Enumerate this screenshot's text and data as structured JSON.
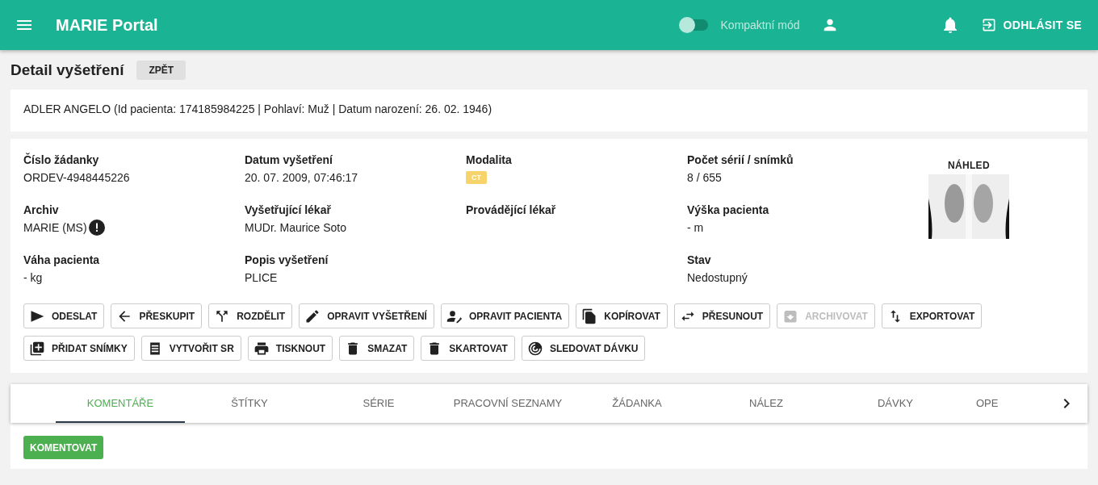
{
  "header": {
    "title": "MARIE Portal",
    "compact_mode": {
      "label": "Kompaktní mód",
      "on": false
    },
    "logout": "ODHLÁSIT SE"
  },
  "page": {
    "title": "Detail vyšetření",
    "back": "ZPĚT"
  },
  "patient": "ADLER ANGELO (Id pacienta: 174185984225 | Pohlaví: Muž | Datum narození: 26. 02. 1946)",
  "columns": [
    [
      {
        "label": "Číslo žádanky",
        "value": "ORDEV-4948445226"
      },
      {
        "label": "Archiv",
        "value": "MARIE (MS)",
        "warning": true
      },
      {
        "label": "Váha pacienta",
        "value": "- kg"
      }
    ],
    [
      {
        "label": "Datum vyšetření",
        "value": "20. 07. 2009, 07:46:17"
      },
      {
        "label": "Vyšetřující lékař",
        "value": "MUDr. Maurice Soto"
      },
      {
        "label": "Popis vyšetření",
        "value": "PLICE"
      }
    ],
    [
      {
        "label": "Modalita",
        "badge": "CT"
      },
      {
        "label": "Provádějící lékař"
      }
    ],
    [
      {
        "label": "Počet sérií / snímků",
        "value": "8 / 655"
      },
      {
        "label": "Výška pacienta",
        "value": "- m"
      },
      {
        "label": "Stav",
        "value": "Nedostupný"
      }
    ]
  ],
  "preview": {
    "label": "NÁHLED"
  },
  "actions": [
    [
      {
        "label": "ODESLAT",
        "disabled": false
      },
      {
        "label": "PŘESKUPIT",
        "disabled": false
      },
      {
        "label": "ROZDĚLIT",
        "disabled": false
      },
      {
        "label": "OPRAVIT VYŠETŘENÍ",
        "disabled": false
      },
      {
        "label": "OPRAVIT PACIENTA",
        "disabled": false
      },
      {
        "label": "KOPÍROVAT",
        "disabled": false
      },
      {
        "label": "PŘESUNOUT",
        "disabled": false
      },
      {
        "label": "ARCHIVOVAT",
        "disabled": true
      },
      {
        "label": "EXPORTOVAT",
        "disabled": false
      }
    ],
    [
      {
        "label": "PŘIDAT SNÍMKY",
        "disabled": false
      },
      {
        "label": "VYTVOŘIT SR",
        "disabled": false
      },
      {
        "label": "TISKNOUT",
        "disabled": false
      },
      {
        "label": "SMAZAT",
        "disabled": false
      },
      {
        "label": "SKARTOVAT",
        "disabled": false
      },
      {
        "label": "SLEDOVAT DÁVKU",
        "disabled": false
      }
    ]
  ],
  "tabs": [
    {
      "label": "KOMENTÁŘE",
      "selected": true
    },
    {
      "label": "ŠTÍTKY",
      "selected": false
    },
    {
      "label": "SÉRIE",
      "selected": false
    },
    {
      "label": "PRACOVNÍ SEZNAMY",
      "selected": false
    },
    {
      "label": "ŽÁDANKA",
      "selected": false
    },
    {
      "label": "NÁLEZ",
      "selected": false
    },
    {
      "label": "DÁVKY",
      "selected": false
    },
    {
      "label": "OPE",
      "selected": false
    }
  ],
  "comment_button": "KOMENTOVAT"
}
